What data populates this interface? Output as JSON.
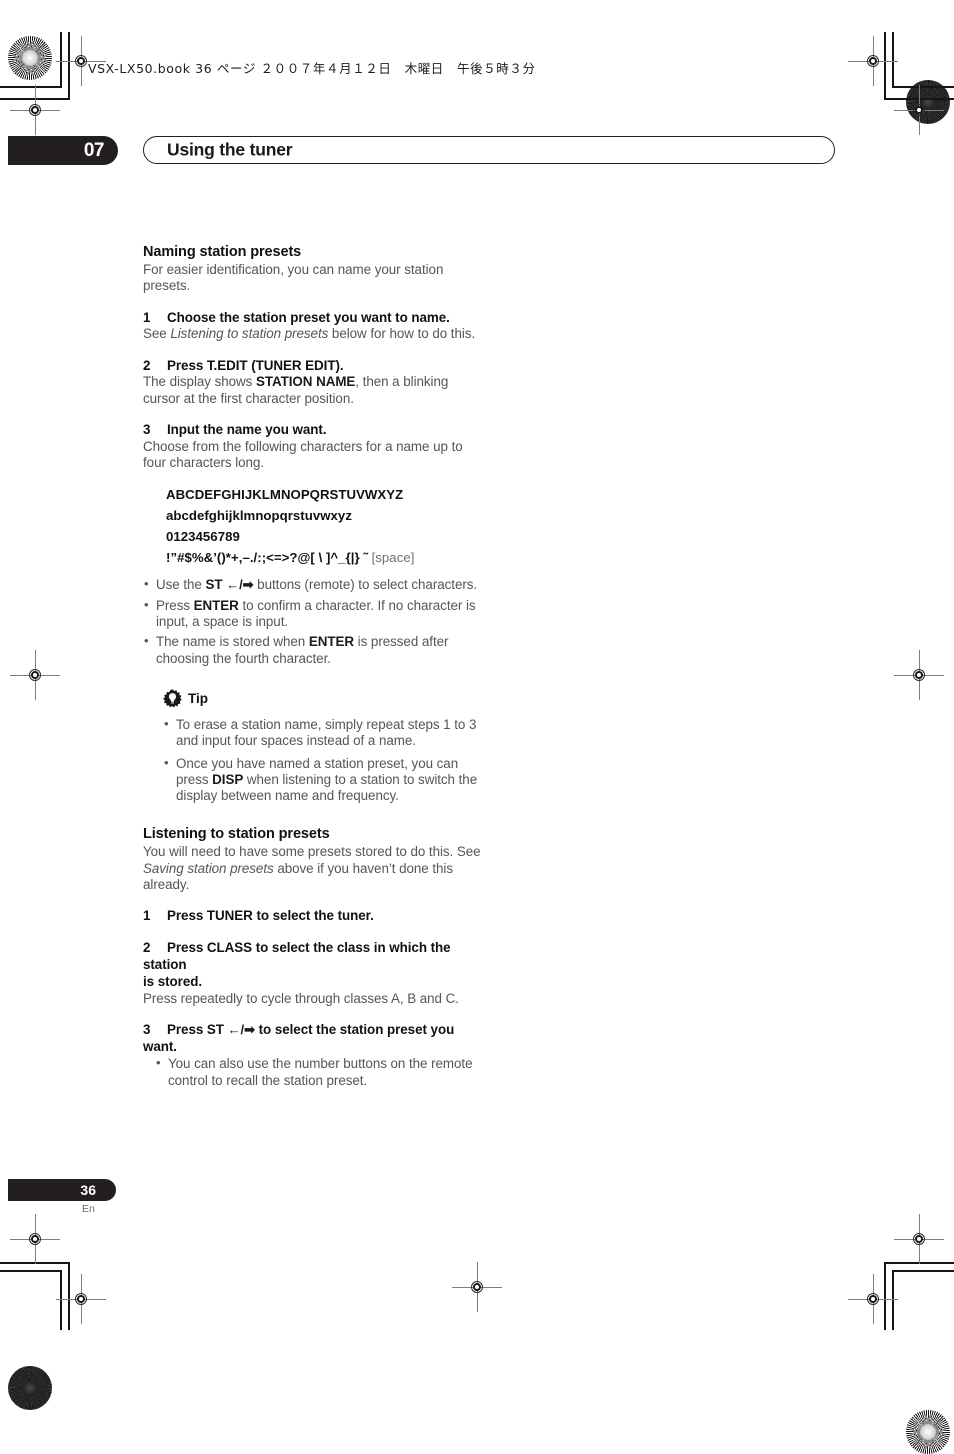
{
  "print_marks": {
    "header_note": "VSX-LX50.book  36 ページ  ２００７年４月１２日　木曜日　午後５時３分"
  },
  "chapter": {
    "number": "07",
    "title": "Using the tuner"
  },
  "sections": [
    {
      "heading": "Naming station presets",
      "intro": "For easier identification, you can name your station presets."
    },
    {
      "heading": "Listening to station presets",
      "intro_a": "You will need to have some presets stored to do this. See ",
      "intro_italic": "Saving station presets",
      "intro_b": " above if you haven’t done this already."
    }
  ],
  "naming_steps": {
    "step1": {
      "num": "1",
      "head": "Choose the station preset you want to name.",
      "body_a": "See ",
      "body_italic": "Listening to station presets",
      "body_b": " below for how to do this."
    },
    "step2": {
      "num": "2",
      "head": "Press T.EDIT (TUNER EDIT).",
      "body_a": "The display shows ",
      "body_bold": "STATION NAME",
      "body_b": ", then a blinking cursor at the first character position."
    },
    "step3": {
      "num": "3",
      "head": "Input the name you want.",
      "body": "Choose from the following characters for a name up to four characters long."
    }
  },
  "character_set": {
    "uppercase": "ABCDEFGHIJKLMNOPQRSTUVWXYZ",
    "lowercase": "abcdefghijklmnopqrstuvwxyz",
    "digits": "0123456789",
    "symbols": "!”#$%&’()*+,–./:;<=>?@[ \\ ]^_{|} ˜",
    "space_label": "[space]"
  },
  "naming_notes": [
    {
      "a": "Use the ",
      "bold": "ST",
      "arrows": "←/➡",
      "b": " buttons (remote) to select characters."
    },
    {
      "a": "Press ",
      "bold": "ENTER",
      "b": " to confirm a character. If no character is input, a space is input."
    },
    {
      "a": "The name is stored when ",
      "bold": "ENTER",
      "b": " is pressed after choosing the fourth character."
    }
  ],
  "tip": {
    "icon": "tip-gear-bulb-icon",
    "label": "Tip",
    "notes": [
      {
        "a": "To erase a station name, simply repeat steps 1 to 3 and input four spaces instead of a name."
      },
      {
        "a": "Once you have named a station preset, you can press ",
        "bold": "DISP",
        "b": " when listening to a station to switch the display between name and frequency."
      }
    ]
  },
  "listening_steps": {
    "step1": {
      "num": "1",
      "head": "Press TUNER to select the tuner."
    },
    "step2": {
      "num": "2",
      "head": "Press CLASS to select the class in which the station",
      "head_cont": "is stored.",
      "body": "Press repeatedly to cycle through classes A, B and C."
    },
    "step3": {
      "num": "3",
      "head_a": "Press ST ",
      "arrows": "←/➡",
      "head_b": " to select the station preset you want.",
      "note": "You can also use the number buttons on the remote control to recall the station preset."
    }
  },
  "footer": {
    "page_number": "36",
    "language": "En"
  },
  "colors": {
    "ink": "#231f20",
    "body_gray": "#55555a",
    "heading": "#111111"
  }
}
